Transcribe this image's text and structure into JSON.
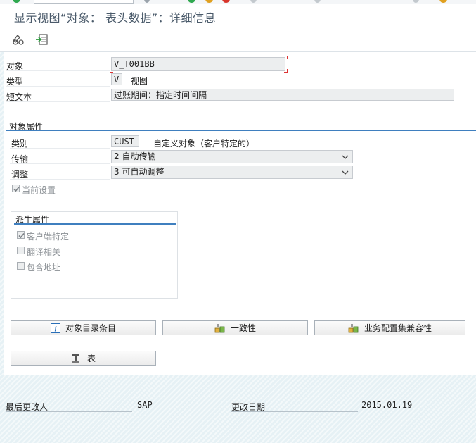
{
  "window": {
    "title": "显示视图“对象： 表头数据”：详细信息"
  },
  "toolbar": {
    "items": [
      {
        "icon": "glasses-icon"
      },
      {
        "icon": "export-icon"
      }
    ]
  },
  "header": {
    "object_label": "对象",
    "object_value": "V_T001BB",
    "type_label": "类型",
    "type_value": "V",
    "type_text": "视图",
    "short_text_label": "短文本",
    "short_text_value": "过账期间：指定时间间隔"
  },
  "object_attributes": {
    "section_title": "对象属性",
    "category_label": "类别",
    "category_value": "CUST",
    "category_text": "自定义对象（客户特定的）",
    "transport_label": "传输",
    "transport_value": "2 自动传输",
    "adjust_label": "调整",
    "adjust_value": "3 可自动调整",
    "current_settings_label": "当前设置",
    "current_settings_checked": true
  },
  "derived_attributes": {
    "section_title": "派生属性",
    "items": [
      {
        "label": "客户端特定",
        "checked": true
      },
      {
        "label": "翻译相关",
        "checked": false
      },
      {
        "label": "包含地址",
        "checked": false
      }
    ]
  },
  "buttons": {
    "directory_label": "对象目录条目",
    "consistency_label": "一致性",
    "bc_compat_label": "业务配置集兼容性",
    "tables_label": "表"
  },
  "footer": {
    "changed_by_label": "最后更改人",
    "changed_by_value": "SAP",
    "changed_on_label": "更改日期",
    "changed_on_value": "2015.01.19"
  },
  "colors": {
    "accent": "#3f7fbf",
    "field_bg": "#eceeef",
    "footer_bg": "#e6f1f5",
    "required_marker": "#dd3333"
  }
}
